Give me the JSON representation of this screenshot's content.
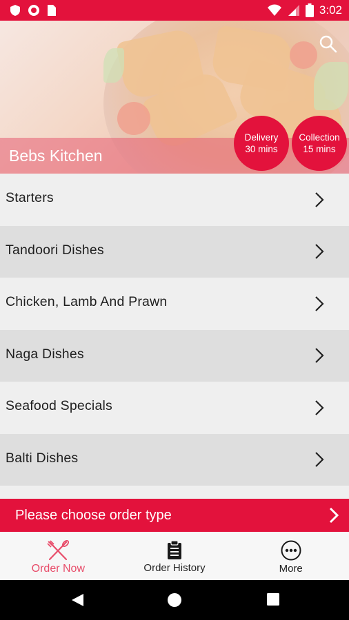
{
  "status_bar": {
    "time": "3:02",
    "icons": [
      "shield-icon",
      "record-icon",
      "sim-icon",
      "wifi-icon",
      "signal-icon",
      "battery-icon"
    ]
  },
  "hero": {
    "restaurant_name": "Bebs Kitchen",
    "search_icon": "search-icon"
  },
  "order_types": {
    "delivery_label": "Delivery",
    "delivery_time": "30 mins",
    "collection_label": "Collection",
    "collection_time": "15 mins"
  },
  "menu": {
    "categories": [
      {
        "label": "Starters"
      },
      {
        "label": "Tandoori Dishes"
      },
      {
        "label": "Chicken, Lamb And Prawn"
      },
      {
        "label": "Naga Dishes"
      },
      {
        "label": "Seafood Specials"
      },
      {
        "label": "Balti Dishes"
      }
    ]
  },
  "order_banner": {
    "label": "Please choose order type"
  },
  "bottom_nav": {
    "items": [
      {
        "label": "Order Now",
        "icon": "fork-knife-icon",
        "active": true
      },
      {
        "label": "Order History",
        "icon": "clipboard-icon",
        "active": false
      },
      {
        "label": "More",
        "icon": "more-icon",
        "active": false
      }
    ]
  },
  "colors": {
    "brand_red": "#e3123c",
    "active_pink": "#e84d6a"
  }
}
